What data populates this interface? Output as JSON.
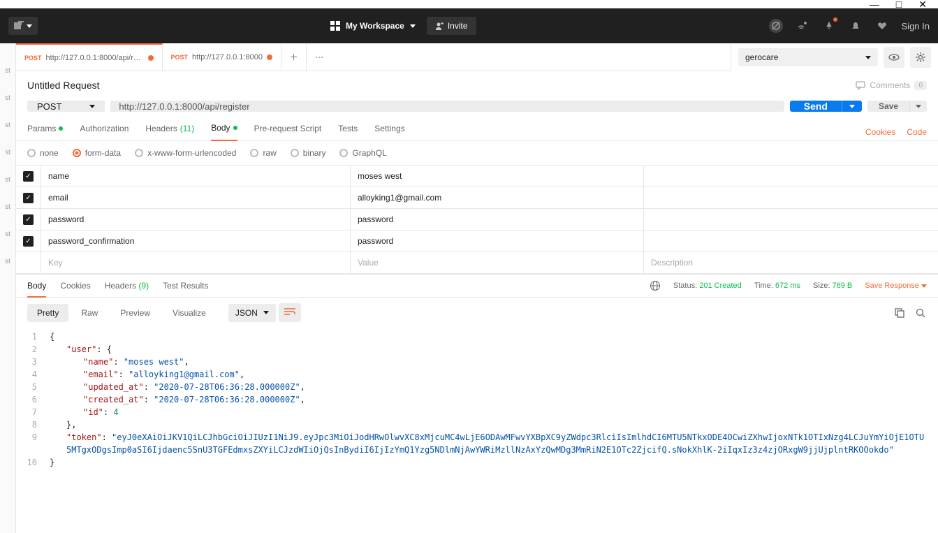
{
  "window": {
    "minimize": "—",
    "maximize": "□",
    "close": "✕"
  },
  "topbar": {
    "workspace_label": "My Workspace",
    "invite_label": "Invite",
    "sign_in": "Sign In"
  },
  "sidebar_rail": {
    "items": [
      "st",
      "st",
      "st",
      "st",
      "st",
      "st",
      "st",
      "st"
    ]
  },
  "tabs": [
    {
      "method": "POST",
      "label": "http://127.0.0.1:8000/api/regis...",
      "dirty": true,
      "active": true
    },
    {
      "method": "POST",
      "label": "http://127.0.0.1:8000",
      "dirty": true,
      "active": false
    }
  ],
  "env": {
    "selected": "gerocare"
  },
  "request": {
    "title": "Untitled Request",
    "comments_label": "Comments",
    "comments_count": "0",
    "method": "POST",
    "url": "http://127.0.0.1:8000/api/register",
    "send": "Send",
    "save": "Save"
  },
  "req_tabs": {
    "params": "Params",
    "auth": "Authorization",
    "headers": "Headers",
    "headers_count": "(11)",
    "body": "Body",
    "prerequest": "Pre-request Script",
    "tests": "Tests",
    "settings": "Settings",
    "cookies": "Cookies",
    "code": "Code"
  },
  "body_types": {
    "none": "none",
    "form_data": "form-data",
    "urlencoded": "x-www-form-urlencoded",
    "raw": "raw",
    "binary": "binary",
    "graphql": "GraphQL"
  },
  "form_data": {
    "rows": [
      {
        "key": "name",
        "value": "moses west"
      },
      {
        "key": "email",
        "value": "alloyking1@gmail.com"
      },
      {
        "key": "password",
        "value": "password"
      },
      {
        "key": "password_confirmation",
        "value": "password"
      }
    ],
    "placeholders": {
      "key": "Key",
      "value": "Value",
      "description": "Description"
    }
  },
  "response_tabs": {
    "body": "Body",
    "cookies": "Cookies",
    "headers": "Headers",
    "headers_count": "(9)",
    "test_results": "Test Results"
  },
  "response_meta": {
    "status_label": "Status:",
    "status_value": "201 Created",
    "time_label": "Time:",
    "time_value": "672 ms",
    "size_label": "Size:",
    "size_value": "769 B",
    "save_response": "Save Response"
  },
  "viewer": {
    "pretty": "Pretty",
    "raw": "Raw",
    "preview": "Preview",
    "visualize": "Visualize",
    "format": "JSON"
  },
  "response_body": {
    "user": {
      "name": "moses west",
      "email": "alloyking1@gmail.com",
      "updated_at": "2020-07-28T06:36:28.000000Z",
      "created_at": "2020-07-28T06:36:28.000000Z",
      "id": 4
    },
    "token": "eyJ0eXAiOiJKV1QiLCJhbGciOiJIUzI1NiJ9.eyJpc3MiOiJodHRwOlwvXC8xMjcuMC4wLjE6ODAwMFwvYXBpXC9yZWdpc3RlciIsImlhdCI6MTU5NTkxODE4OCwiZXhwIjoxNTk1OTIxNzg4LCJuYmYiOjE1OTU5MTgxODgsImp0aSI6Ijdaenc5SnU3TGFEdmxsZXYiLCJzdWIiOjQsInBydiI6IjIzYmQ1Yzg5NDlmNjAwYWRiMzllNzAxYzQwMDg3MmRiN2E1OTc2ZjcifQ.sNokXhlK-2iIqxIz3z4zjORxgW9jjUjplntRKOOokdo"
  }
}
